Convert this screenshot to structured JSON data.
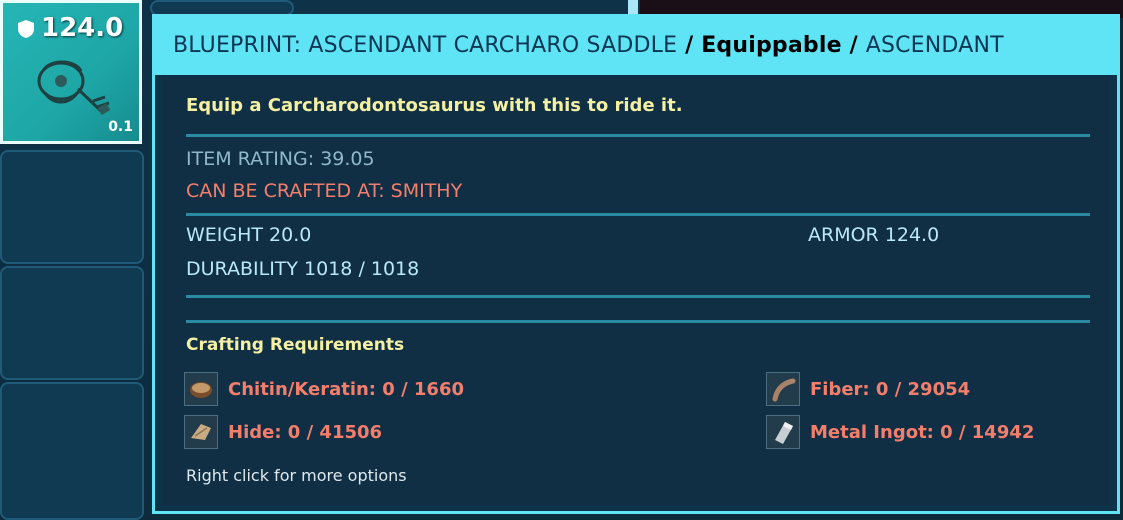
{
  "slot": {
    "armor_value": "124.0",
    "weight": "0.1",
    "icon": "saddle-icon",
    "badge_icon": "shield-icon"
  },
  "tooltip": {
    "title_name": "BLUEPRINT: ASCENDANT CARCHARO SADDLE",
    "title_sep1": " / ",
    "title_type": "Equippable",
    "title_sep2": " / ",
    "title_quality": "ASCENDANT",
    "description": "Equip a Carcharodontosaurus with this to ride it.",
    "item_rating": "ITEM RATING: 39.05",
    "crafted_at": "CAN BE CRAFTED AT: SMITHY",
    "weight": "WEIGHT 20.0",
    "armor": "ARMOR 124.0",
    "durability": "DURABILITY 1018 / 1018",
    "crafting_title": "Crafting Requirements",
    "requirements": [
      {
        "label": "Chitin/Keratin: 0 / 1660",
        "icon": "chitin-icon"
      },
      {
        "label": "Fiber: 0 / 29054",
        "icon": "fiber-icon"
      },
      {
        "label": "Hide: 0 / 41506",
        "icon": "hide-icon"
      },
      {
        "label": "Metal Ingot: 0 / 14942",
        "icon": "metal-ingot-icon"
      }
    ],
    "hint": "Right click for more options"
  },
  "colors": {
    "accent": "#5ee4f5",
    "description": "#f4f0a3",
    "warning": "#f47e6c",
    "stat": "#b9e8f7",
    "panel": "#112f44"
  }
}
